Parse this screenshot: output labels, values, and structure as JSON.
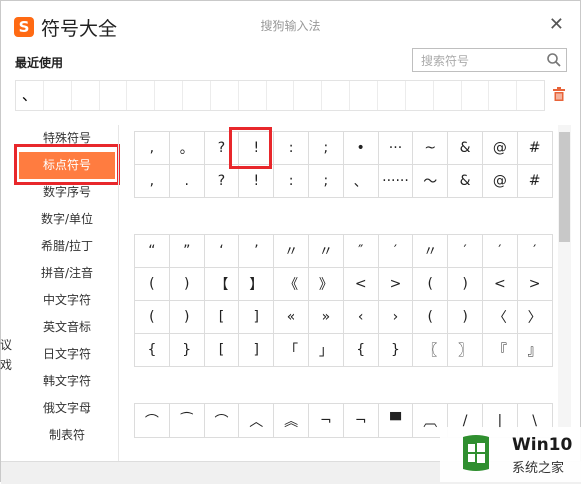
{
  "app": {
    "title": "符号大全",
    "subtitle": "搜狗输入法",
    "close": "✕",
    "logo_letter": "S"
  },
  "recent": {
    "label": "最近使用",
    "symbols": [
      "、",
      "",
      "",
      "",
      "",
      "",
      "",
      "",
      "",
      "",
      "",
      "",
      "",
      "",
      "",
      "",
      "",
      "",
      ""
    ]
  },
  "search": {
    "placeholder": "搜索符号",
    "value": ""
  },
  "sidebar": {
    "items": [
      "特殊符号",
      "标点符号",
      "数字序号",
      "数字/单位",
      "希腊/拉丁",
      "拼音/注音",
      "中文字符",
      "英文音标",
      "日文字符",
      "韩文字符",
      "俄文字母",
      "制表符"
    ],
    "active_index": 1
  },
  "grid1": [
    [
      ",",
      "。",
      "?",
      "!",
      ":",
      ";",
      "•",
      "···",
      "~",
      "&",
      "@",
      "#"
    ],
    [
      ",",
      ".",
      "?",
      "!",
      ":",
      ";",
      "、",
      "······",
      "〜",
      "&",
      "@",
      "#"
    ]
  ],
  "grid2": [
    [
      "“",
      "”",
      "‘",
      "’",
      "〃",
      "〃",
      "″",
      "′",
      "〃",
      "′",
      "′",
      "′"
    ],
    [
      "(",
      ")",
      "【",
      "】",
      "《",
      "》",
      "<",
      ">",
      "(",
      ")",
      "<",
      ">"
    ],
    [
      "(",
      ")",
      "[",
      "]",
      "«",
      "»",
      "‹",
      "›",
      "(",
      ")",
      "〈",
      "〉"
    ],
    [
      "{",
      "}",
      "[",
      "]",
      "「",
      "」",
      "{",
      "}",
      "〖",
      "〗",
      "『",
      "』"
    ]
  ],
  "grid3": [
    [
      "⌒",
      "⁀",
      "⌒",
      "︿",
      "︽",
      "¬",
      "¬",
      "▀",
      "︹",
      "/",
      "|",
      "\\"
    ]
  ],
  "edge_text": [
    "议",
    "戏"
  ],
  "watermark": {
    "line1": "Win10",
    "line2": "系统之家"
  },
  "colors": {
    "accent": "#ff7c40",
    "highlight": "#e8272b",
    "logo": "#ff6a13"
  }
}
